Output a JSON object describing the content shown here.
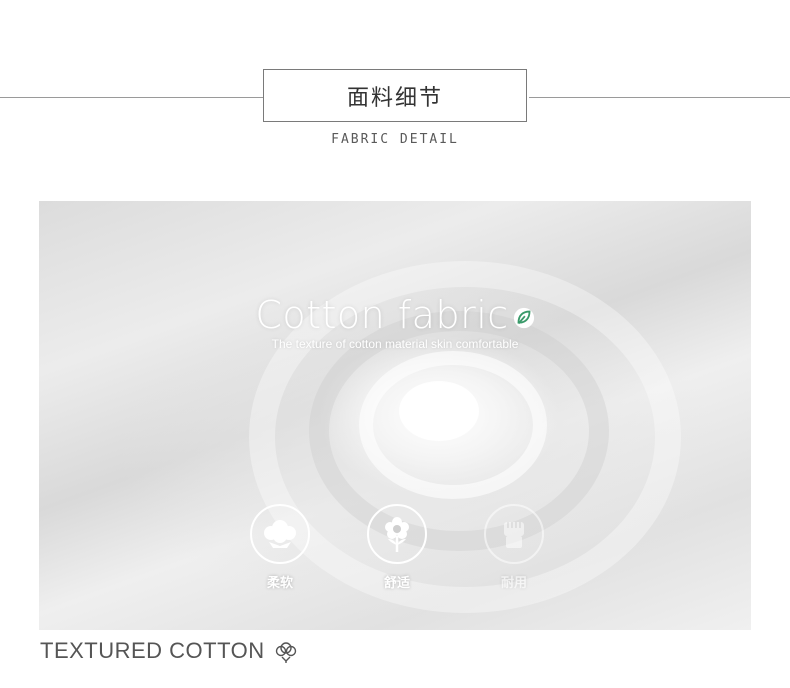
{
  "header": {
    "title": "面料细节",
    "subtitle": "FABRIC DETAIL"
  },
  "photo": {
    "headline": "Cotton fabric",
    "headline_icon": "leaf-icon",
    "tagline": "The texture of cotton material skin comfortable",
    "features": [
      {
        "icon": "cotton-boll-icon",
        "label": "柔软"
      },
      {
        "icon": "flower-icon",
        "label": "舒适"
      },
      {
        "icon": "fist-icon",
        "label": "耐用"
      }
    ]
  },
  "footer": {
    "label": "TEXTURED COTTON",
    "icon": "cotton-flower-icon"
  },
  "colors": {
    "leaf_green": "#3a9a6a",
    "rule_gray": "#9a9a9a",
    "text_dark": "#333333"
  }
}
